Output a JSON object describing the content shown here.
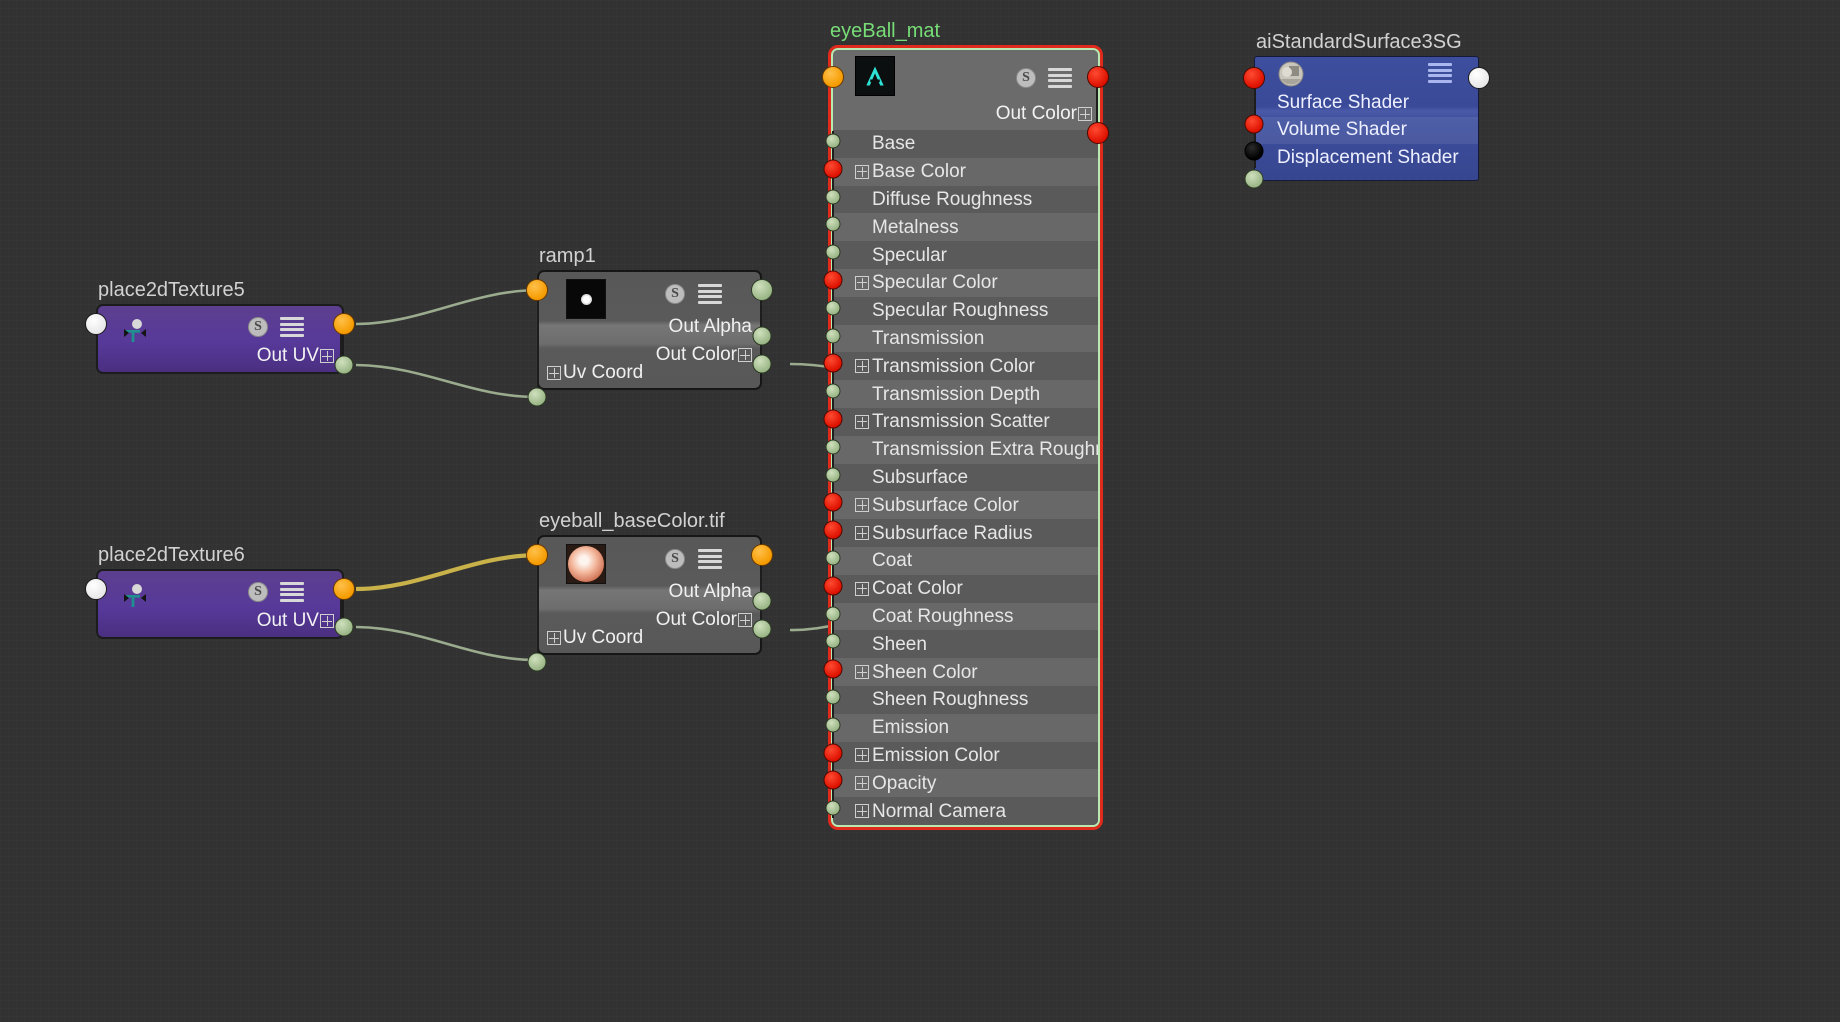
{
  "app": {
    "editor": "Hypershade Node Editor",
    "background_color": "#323232"
  },
  "colors": {
    "wire_default": "#9aab8e",
    "wire_uv": "#c9b24a",
    "wire_shader": "#c0201a",
    "selection_border": "#e02a1c",
    "selection_inner": "#b9e8b0",
    "node_purple": "#57399a",
    "node_grey": "#5f5f5f",
    "node_blue": "#3d4e9e",
    "port_orange": "#f59b00",
    "port_green": "#97b383",
    "port_red": "#dd1100",
    "port_white": "#ffffff",
    "port_black": "#000000",
    "title_selected": "#77dd77"
  },
  "nodes": {
    "place2dTexture5": {
      "title": "place2dTexture5",
      "type": "place2dTexture",
      "icon": "place2d-texture-icon",
      "badges": {
        "s": "S",
        "menu": "hamburger-icon"
      },
      "output_label": "Out UV",
      "ports": {
        "input_top_left": "white",
        "output_top_right": "orange",
        "output_uv": "green"
      }
    },
    "place2dTexture6": {
      "title": "place2dTexture6",
      "type": "place2dTexture",
      "icon": "place2d-texture-icon",
      "badges": {
        "s": "S",
        "menu": "hamburger-icon"
      },
      "output_label": "Out UV",
      "ports": {
        "input_top_left": "white",
        "output_top_right": "orange",
        "output_uv": "green"
      }
    },
    "ramp1": {
      "title": "ramp1",
      "type": "ramp",
      "thumbnail": "ramp-black-white-dot-thumbnail",
      "badges": {
        "s": "S",
        "menu": "hamburger-icon"
      },
      "outputs": [
        "Out Alpha",
        "Out Color"
      ],
      "inputs": [
        "Uv Coord"
      ],
      "ports": {
        "input_top_left": "orange",
        "output_top_right": "green",
        "out_alpha": "green",
        "out_color": "green",
        "uv_coord": "green"
      }
    },
    "eyeball_baseColor": {
      "title": "eyeball_baseColor.tif",
      "type": "file",
      "thumbnail": "eyeball-sphere-thumbnail",
      "badges": {
        "s": "S",
        "menu": "hamburger-icon"
      },
      "outputs": [
        "Out Alpha",
        "Out Color"
      ],
      "inputs": [
        "Uv Coord"
      ],
      "ports": {
        "input_top_left": "orange",
        "output_top_right": "orange",
        "out_alpha": "green",
        "out_color": "green",
        "uv_coord": "green"
      }
    },
    "eyeBall_mat": {
      "title": "eyeBall_mat",
      "type": "aiStandardSurface",
      "selected": true,
      "thumbnail": "arnold-logo-icon",
      "badges": {
        "s": "S",
        "menu": "hamburger-icon"
      },
      "output_label": "Out Color",
      "ports": {
        "input_top_left": "orange",
        "output_top_right": "red",
        "out_color": "red"
      },
      "attributes": [
        {
          "label": "Base",
          "port": "green",
          "expandable": false
        },
        {
          "label": "Base Color",
          "port": "red",
          "expandable": true
        },
        {
          "label": "Diffuse Roughness",
          "port": "green",
          "expandable": false
        },
        {
          "label": "Metalness",
          "port": "green",
          "expandable": false
        },
        {
          "label": "Specular",
          "port": "green",
          "expandable": false
        },
        {
          "label": "Specular Color",
          "port": "red",
          "expandable": true
        },
        {
          "label": "Specular Roughness",
          "port": "green",
          "expandable": false
        },
        {
          "label": "Transmission",
          "port": "green",
          "expandable": false
        },
        {
          "label": "Transmission Color",
          "port": "red",
          "expandable": true
        },
        {
          "label": "Transmission Depth",
          "port": "green",
          "expandable": false
        },
        {
          "label": "Transmission Scatter",
          "port": "red",
          "expandable": true
        },
        {
          "label": "Transmission Extra Roughness",
          "port": "green",
          "expandable": false
        },
        {
          "label": "Subsurface",
          "port": "green",
          "expandable": false
        },
        {
          "label": "Subsurface Color",
          "port": "red",
          "expandable": true
        },
        {
          "label": "Subsurface Radius",
          "port": "red",
          "expandable": true
        },
        {
          "label": "Coat",
          "port": "green",
          "expandable": false
        },
        {
          "label": "Coat Color",
          "port": "red",
          "expandable": true
        },
        {
          "label": "Coat Roughness",
          "port": "green",
          "expandable": false
        },
        {
          "label": "Sheen",
          "port": "green",
          "expandable": false
        },
        {
          "label": "Sheen Color",
          "port": "red",
          "expandable": true
        },
        {
          "label": "Sheen Roughness",
          "port": "green",
          "expandable": false
        },
        {
          "label": "Emission",
          "port": "green",
          "expandable": false
        },
        {
          "label": "Emission Color",
          "port": "red",
          "expandable": true
        },
        {
          "label": "Opacity",
          "port": "red",
          "expandable": true
        },
        {
          "label": "Normal Camera",
          "port": "green",
          "expandable": true
        }
      ]
    },
    "aiStandardSurface3SG": {
      "title": "aiStandardSurface3SG",
      "type": "shadingEngine",
      "thumbnail": "shader-ball-icon",
      "badges": {
        "menu": "hamburger-icon"
      },
      "ports": {
        "input_top_left": "red",
        "output_top_right": "white"
      },
      "attributes": [
        {
          "label": "Surface Shader",
          "port": "red"
        },
        {
          "label": "Volume Shader",
          "port": "black"
        },
        {
          "label": "Displacement Shader",
          "port": "green"
        }
      ]
    }
  },
  "connections": [
    {
      "from": "place2dTexture5.Out UV",
      "to": "ramp1.Uv Coord",
      "color": "#9aab8e"
    },
    {
      "from": "place2dTexture5.output_top_right",
      "to": "ramp1.input_top_left",
      "color": "#9aab8e"
    },
    {
      "from": "place2dTexture6.Out UV",
      "to": "eyeball_baseColor.Uv Coord",
      "color": "#9aab8e"
    },
    {
      "from": "place2dTexture6.output_top_right",
      "to": "eyeball_baseColor.input_top_left",
      "color": "#c9b24a"
    },
    {
      "from": "ramp1.Out Color",
      "to": "eyeBall_mat.Transmission",
      "color": "#9aab8e"
    },
    {
      "from": "eyeball_baseColor.Out Color",
      "to": "eyeBall_mat.Subsurface Color",
      "color": "#9aab8e"
    },
    {
      "from": "eyeBall_mat.Out Color",
      "to": "aiStandardSurface3SG.Surface Shader",
      "color": "#c0201a"
    }
  ]
}
